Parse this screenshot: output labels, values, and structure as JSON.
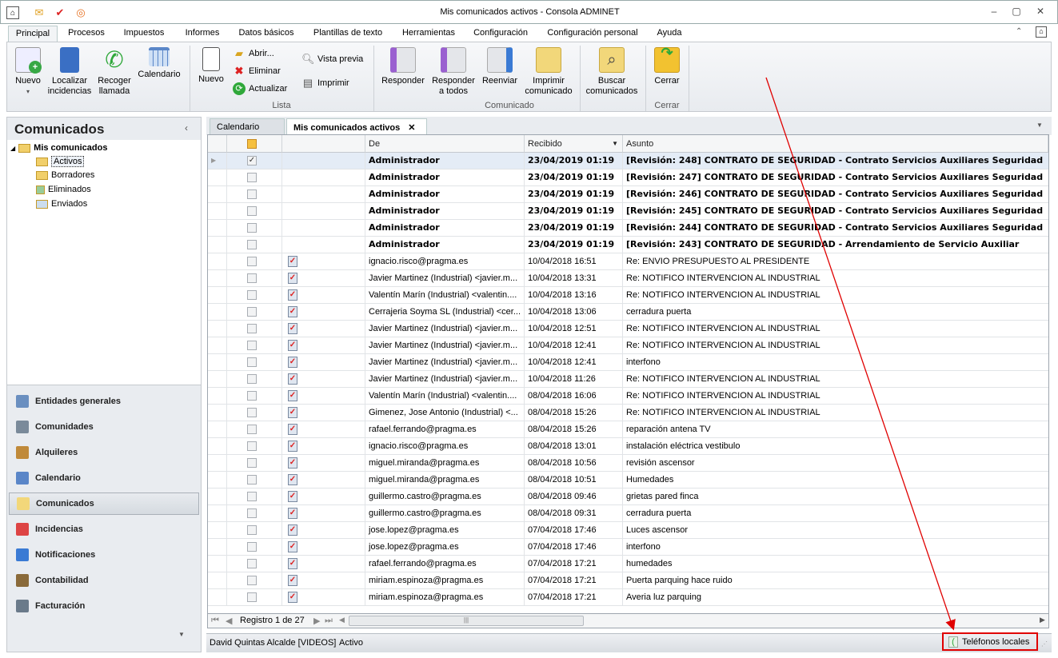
{
  "window": {
    "title": "Mis comunicados activos - Consola ADMINET",
    "controls": [
      "–",
      "▢",
      "✕"
    ]
  },
  "ribbon_tabs": [
    "Principal",
    "Procesos",
    "Impuestos",
    "Informes",
    "Datos básicos",
    "Plantillas de texto",
    "Herramientas",
    "Configuración",
    "Configuración personal",
    "Ayuda"
  ],
  "ribbon": {
    "large": [
      {
        "label": "Nuevo",
        "sub": "▾",
        "color": "#37a845"
      },
      {
        "label": "Localizar incidencias",
        "color": "#3a6fc4"
      },
      {
        "label": "Recoger llamada",
        "color": "#2fa83a"
      },
      {
        "label": "Calendario",
        "color": "#5a86c8"
      },
      {
        "label": "Nuevo",
        "color": "#ffffff"
      },
      {
        "label": "Responder",
        "color": "#b9a3d9"
      },
      {
        "label": "Responder a todos",
        "color": "#b9a3d9"
      },
      {
        "label": "Reenviar",
        "color": "#8fb0e0"
      },
      {
        "label": "Imprimir comunicado",
        "color": "#f2d77a"
      },
      {
        "label": "Buscar comunicados",
        "color": "#f2d77a"
      },
      {
        "label": "Cerrar",
        "color": "#f2c230"
      }
    ],
    "small": [
      {
        "label": "Abrir...",
        "icon": "📂"
      },
      {
        "label": "Eliminar",
        "icon": "✖"
      },
      {
        "label": "Actualizar",
        "icon": "⟳"
      },
      {
        "label": "Vista previa",
        "icon": "🔍"
      },
      {
        "label": "Imprimir",
        "icon": "🖶"
      }
    ],
    "groups": [
      "Lista",
      "Comunicado",
      "Cerrar"
    ]
  },
  "left": {
    "title": "Comunicados",
    "tree_root": "Mis comunicados",
    "tree": [
      "Activos",
      "Borradores",
      "Eliminados",
      "Enviados"
    ],
    "nav": [
      {
        "label": "Entidades generales",
        "color": "#6a8fc0"
      },
      {
        "label": "Comunidades",
        "color": "#7a8a9a"
      },
      {
        "label": "Alquileres",
        "color": "#c08a3a"
      },
      {
        "label": "Calendario",
        "color": "#5a86c8"
      },
      {
        "label": "Comunicados",
        "color": "#f2d77a"
      },
      {
        "label": "Incidencias",
        "color": "#d44"
      },
      {
        "label": "Notificaciones",
        "color": "#3a7ad4"
      },
      {
        "label": "Contabilidad",
        "color": "#8a6a3a"
      },
      {
        "label": "Facturación",
        "color": "#6a7a8a"
      }
    ]
  },
  "doc_tabs": [
    "Calendario",
    "Mis comunicados activos"
  ],
  "grid": {
    "headers": [
      "De",
      "Recibido",
      "Asunto"
    ],
    "rows": [
      [
        "Administrador",
        "23/04/2019 01:19",
        "[Revisión: 248] CONTRATO DE SEGURIDAD - Contrato Servicios Auxiliares Seguridad"
      ],
      [
        "Administrador",
        "23/04/2019 01:19",
        "[Revisión: 247] CONTRATO DE SEGURIDAD - Contrato Servicios Auxiliares Seguridad"
      ],
      [
        "Administrador",
        "23/04/2019 01:19",
        "[Revisión: 246] CONTRATO DE SEGURIDAD - Contrato Servicios Auxiliares Seguridad"
      ],
      [
        "Administrador",
        "23/04/2019 01:19",
        "[Revisión: 245] CONTRATO DE SEGURIDAD - Contrato Servicios Auxiliares Seguridad"
      ],
      [
        "Administrador",
        "23/04/2019 01:19",
        "[Revisión: 244] CONTRATO DE SEGURIDAD - Contrato Servicios Auxiliares Seguridad"
      ],
      [
        "Administrador",
        "23/04/2019 01:19",
        "[Revisión: 243] CONTRATO DE SEGURIDAD - Arrendamiento de Servicio Auxiliar"
      ],
      [
        "ignacio.risco@pragma.es",
        "10/04/2018 16:51",
        "Re: ENVIO PRESUPUESTO AL PRESIDENTE"
      ],
      [
        "Javier Martinez (Industrial) <javier.m...",
        "10/04/2018 13:31",
        "Re: NOTIFICO INTERVENCION AL INDUSTRIAL"
      ],
      [
        "Valentín Marín (Industrial) <valentin....",
        "10/04/2018 13:16",
        "Re: NOTIFICO INTERVENCION AL INDUSTRIAL"
      ],
      [
        "Cerrajeria Soyma SL (Industrial) <cer...",
        "10/04/2018 13:06",
        "cerradura puerta"
      ],
      [
        "Javier Martinez (Industrial) <javier.m...",
        "10/04/2018 12:51",
        "Re: NOTIFICO INTERVENCION AL INDUSTRIAL"
      ],
      [
        "Javier Martinez (Industrial) <javier.m...",
        "10/04/2018 12:41",
        "Re: NOTIFICO INTERVENCION AL INDUSTRIAL"
      ],
      [
        "Javier Martinez (Industrial) <javier.m...",
        "10/04/2018 12:41",
        "interfono"
      ],
      [
        "Javier Martinez (Industrial) <javier.m...",
        "10/04/2018 11:26",
        "Re: NOTIFICO INTERVENCION AL INDUSTRIAL"
      ],
      [
        "Valentín Marín (Industrial) <valentin....",
        "08/04/2018 16:06",
        "Re: NOTIFICO INTERVENCION AL INDUSTRIAL"
      ],
      [
        "Gimenez, Jose Antonio (Industrial) <...",
        "08/04/2018 15:26",
        "Re: NOTIFICO INTERVENCION AL INDUSTRIAL"
      ],
      [
        "rafael.ferrando@pragma.es",
        "08/04/2018 15:26",
        "reparación antena TV"
      ],
      [
        "ignacio.risco@pragma.es",
        "08/04/2018 13:01",
        "instalación eléctrica vestibulo"
      ],
      [
        "miguel.miranda@pragma.es",
        "08/04/2018 10:56",
        "revisión ascensor"
      ],
      [
        "miguel.miranda@pragma.es",
        "08/04/2018 10:51",
        "Humedades"
      ],
      [
        "guillermo.castro@pragma.es",
        "08/04/2018 09:46",
        "grietas pared finca"
      ],
      [
        "guillermo.castro@pragma.es",
        "08/04/2018 09:31",
        "cerradura puerta"
      ],
      [
        "jose.lopez@pragma.es",
        "07/04/2018 17:46",
        "Luces ascensor"
      ],
      [
        "jose.lopez@pragma.es",
        "07/04/2018 17:46",
        "interfono"
      ],
      [
        "rafael.ferrando@pragma.es",
        "07/04/2018 17:21",
        "humedades"
      ],
      [
        "miriam.espinoza@pragma.es",
        "07/04/2018 17:21",
        "Puerta parquing hace ruido"
      ],
      [
        "miriam.espinoza@pragma.es",
        "07/04/2018 17:21",
        "Averia luz parquing"
      ]
    ],
    "bold_count": 6
  },
  "pager": {
    "text": "Registro 1 de 27"
  },
  "status": {
    "user": "David Quintas Alcalde [VIDEOS]",
    "state": "Activo",
    "phones": "Teléfonos locales"
  },
  "colors": {
    "annotation": "#e00000"
  }
}
